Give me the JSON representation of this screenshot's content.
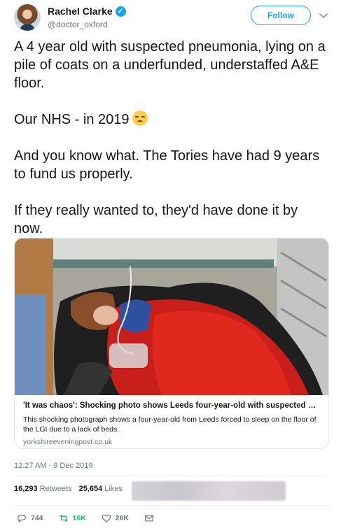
{
  "user": {
    "display_name": "Rachel Clarke",
    "handle": "@doctor_oxford",
    "follow_label": "Follow"
  },
  "tweet": {
    "paragraphs": [
      "A 4 year old with suspected pneumonia, lying on a pile of coats on a underfunded, understaffed A&E floor.",
      "Our NHS - in 2019",
      "And you know what. The Tories have had 9 years to fund us properly.",
      "If they really wanted to, they'd have done it by now."
    ],
    "emoji": "pensive-face"
  },
  "card": {
    "title": "'It was chaos': Shocking photo shows Leeds four-year-old with suspected pneumon...",
    "description": "This shocking photograph shows a four-year-old from Leeds forced to sleep on the floor of the LGI due to a lack of beds.",
    "domain": "yorkshireeveningpost.co.uk"
  },
  "meta": {
    "timestamp": "12:27 AM - 9 Dec 2019",
    "retweets_count": "16,293",
    "retweets_label": "Retweets",
    "likes_count": "25,654",
    "likes_label": "Likes"
  },
  "actions": {
    "replies": "744",
    "retweets": "16K",
    "likes": "26K"
  },
  "colors": {
    "brand": "#1da1f2",
    "retweet_green": "#17bf63",
    "muted": "#657786",
    "border": "#e1e8ed"
  }
}
